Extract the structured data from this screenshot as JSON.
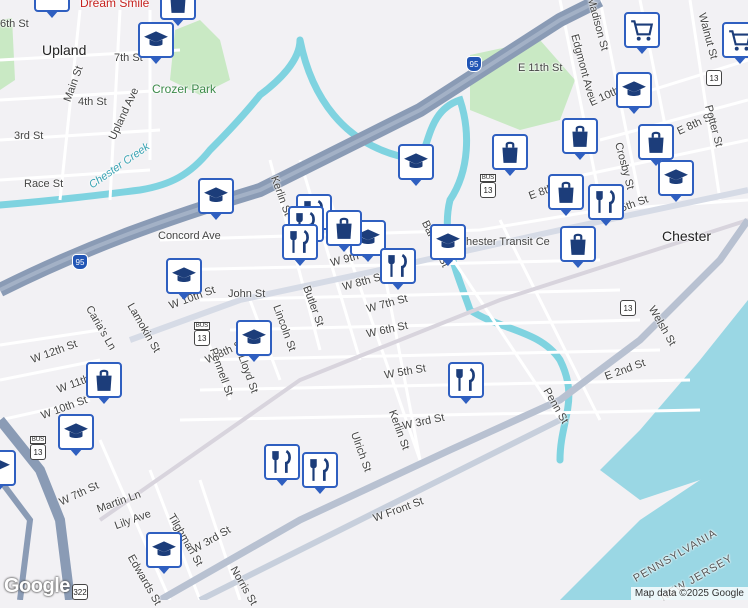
{
  "map": {
    "cities": {
      "upland": "Upland",
      "chester": "Chester"
    },
    "parks": {
      "crozer_park": "Crozer Park"
    },
    "waterways": {
      "chester_creek": "Chester Creek"
    },
    "states": {
      "pennsylvania": "PENNSYLVANIA",
      "new_jersey": "NEW JERSEY"
    },
    "business": {
      "dream_smile": "Dream Smile"
    },
    "streets": [
      "6th St",
      "7th St",
      "Main St",
      "4th St",
      "3rd St",
      "Race St",
      "Upland Ave",
      "Concord Ave",
      "W 9th St",
      "W 8th St",
      "W 7th St",
      "W 6th St",
      "W 5th St",
      "W 3rd St",
      "W 10th St",
      "John St",
      "Butler St",
      "Lincoln St",
      "Lamokin St",
      "Caria's Ln",
      "W 12th St",
      "W 11th St",
      "W 10th St",
      "W 8th St",
      "Lloyd St",
      "Pennell St",
      "W 7th St",
      "Martin Ln",
      "Lily Ave",
      "Tilghman St",
      "W 3rd St",
      "Edwards St",
      "Norris St",
      "Ulrich St",
      "Kerlin St",
      "Kerlin St",
      "W Front St",
      "Barclay St",
      "E 8th St",
      "E 11th St",
      "E 10th St",
      "E 8th St",
      "Edgmont Ave",
      "Madison St",
      "Walnut St",
      "Crosby St",
      "Potter St",
      "5th St",
      "Welsh St",
      "E 2nd St",
      "Penn St",
      "hester Transit Ce"
    ],
    "route_shields": [
      "95",
      "95",
      "13",
      "13",
      "13",
      "13",
      "322",
      "13"
    ],
    "poi_pins": [
      "school-pin",
      "school-pin",
      "school-pin",
      "school-pin",
      "school-pin",
      "school-pin",
      "school-pin",
      "school-pin",
      "school-pin",
      "school-pin",
      "school-pin",
      "restaurant-pin",
      "restaurant-pin",
      "restaurant-pin",
      "restaurant-pin",
      "restaurant-pin",
      "restaurant-pin",
      "restaurant-pin",
      "restaurant-pin",
      "shopping-pin",
      "shopping-pin",
      "shopping-pin",
      "shopping-pin",
      "shopping-pin",
      "shopping-pin",
      "grocery-pin",
      "grocery-pin"
    ]
  },
  "footer": {
    "google_logo": "Google",
    "attribution": "Map data ©2025 Google"
  },
  "colors": {
    "land": "#f2f1f4",
    "water": "#9ad7e4",
    "creek": "#7fd3e0",
    "park": "#c9e9c4",
    "highway": "#8a9bb5",
    "pin_border": "#2f5fc0"
  }
}
